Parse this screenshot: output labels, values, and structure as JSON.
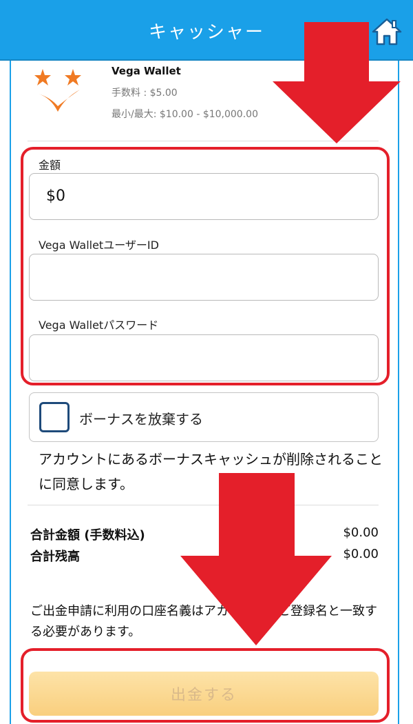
{
  "header": {
    "title": "キャッシャー"
  },
  "payment_method": {
    "name": "Vega Wallet",
    "fee": "手数料 : $5.00",
    "limit": "最小/最大: $10.00 - $10,000.00"
  },
  "form": {
    "amount_label": "金額",
    "amount_value": "$0",
    "user_id_label": "Vega WalletユーザーID",
    "password_label": "Vega Walletパスワード"
  },
  "bonus": {
    "label": "ボーナスを放棄する",
    "consent": "アカウントにあるボーナスキャッシュが削除されることに同意します。"
  },
  "summary": {
    "total_label": "合計金額 (手数料込)",
    "total_value": "$0.00",
    "balance_label": "合計残高",
    "balance_value": "$0.00"
  },
  "notice": "ご出金申請に利用の口座名義はアカウントのご登録名と一致する必要があります。",
  "submit_label": "出金する",
  "colors": {
    "header": "#1aa0e8",
    "annotation": "#e41f2a",
    "submit": "#f9cf7e",
    "checkbox_border": "#1e4a7a",
    "logo_orange": "#f07a23"
  },
  "icons": {
    "home": "home-icon",
    "logo": "vega-wallet-logo",
    "annotation": "arrow-down-icon"
  }
}
